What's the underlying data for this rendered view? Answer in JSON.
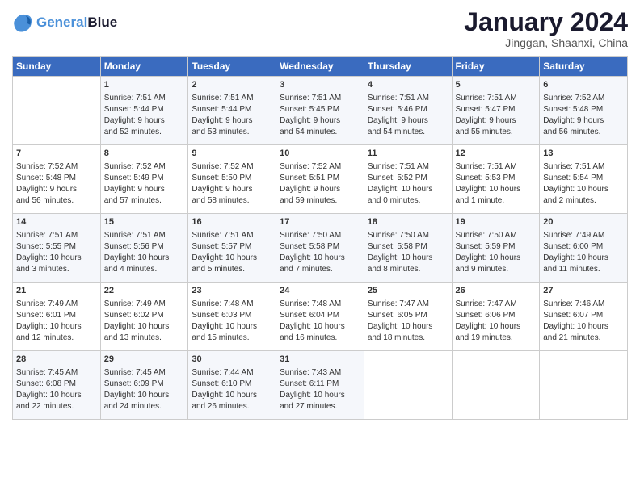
{
  "header": {
    "logo_line1": "General",
    "logo_line2": "Blue",
    "month": "January 2024",
    "location": "Jinggan, Shaanxi, China"
  },
  "weekdays": [
    "Sunday",
    "Monday",
    "Tuesday",
    "Wednesday",
    "Thursday",
    "Friday",
    "Saturday"
  ],
  "weeks": [
    [
      {
        "day": "",
        "info": ""
      },
      {
        "day": "1",
        "info": "Sunrise: 7:51 AM\nSunset: 5:44 PM\nDaylight: 9 hours\nand 52 minutes."
      },
      {
        "day": "2",
        "info": "Sunrise: 7:51 AM\nSunset: 5:44 PM\nDaylight: 9 hours\nand 53 minutes."
      },
      {
        "day": "3",
        "info": "Sunrise: 7:51 AM\nSunset: 5:45 PM\nDaylight: 9 hours\nand 54 minutes."
      },
      {
        "day": "4",
        "info": "Sunrise: 7:51 AM\nSunset: 5:46 PM\nDaylight: 9 hours\nand 54 minutes."
      },
      {
        "day": "5",
        "info": "Sunrise: 7:51 AM\nSunset: 5:47 PM\nDaylight: 9 hours\nand 55 minutes."
      },
      {
        "day": "6",
        "info": "Sunrise: 7:52 AM\nSunset: 5:48 PM\nDaylight: 9 hours\nand 56 minutes."
      }
    ],
    [
      {
        "day": "7",
        "info": "Sunrise: 7:52 AM\nSunset: 5:48 PM\nDaylight: 9 hours\nand 56 minutes."
      },
      {
        "day": "8",
        "info": "Sunrise: 7:52 AM\nSunset: 5:49 PM\nDaylight: 9 hours\nand 57 minutes."
      },
      {
        "day": "9",
        "info": "Sunrise: 7:52 AM\nSunset: 5:50 PM\nDaylight: 9 hours\nand 58 minutes."
      },
      {
        "day": "10",
        "info": "Sunrise: 7:52 AM\nSunset: 5:51 PM\nDaylight: 9 hours\nand 59 minutes."
      },
      {
        "day": "11",
        "info": "Sunrise: 7:51 AM\nSunset: 5:52 PM\nDaylight: 10 hours\nand 0 minutes."
      },
      {
        "day": "12",
        "info": "Sunrise: 7:51 AM\nSunset: 5:53 PM\nDaylight: 10 hours\nand 1 minute."
      },
      {
        "day": "13",
        "info": "Sunrise: 7:51 AM\nSunset: 5:54 PM\nDaylight: 10 hours\nand 2 minutes."
      }
    ],
    [
      {
        "day": "14",
        "info": "Sunrise: 7:51 AM\nSunset: 5:55 PM\nDaylight: 10 hours\nand 3 minutes."
      },
      {
        "day": "15",
        "info": "Sunrise: 7:51 AM\nSunset: 5:56 PM\nDaylight: 10 hours\nand 4 minutes."
      },
      {
        "day": "16",
        "info": "Sunrise: 7:51 AM\nSunset: 5:57 PM\nDaylight: 10 hours\nand 5 minutes."
      },
      {
        "day": "17",
        "info": "Sunrise: 7:50 AM\nSunset: 5:58 PM\nDaylight: 10 hours\nand 7 minutes."
      },
      {
        "day": "18",
        "info": "Sunrise: 7:50 AM\nSunset: 5:58 PM\nDaylight: 10 hours\nand 8 minutes."
      },
      {
        "day": "19",
        "info": "Sunrise: 7:50 AM\nSunset: 5:59 PM\nDaylight: 10 hours\nand 9 minutes."
      },
      {
        "day": "20",
        "info": "Sunrise: 7:49 AM\nSunset: 6:00 PM\nDaylight: 10 hours\nand 11 minutes."
      }
    ],
    [
      {
        "day": "21",
        "info": "Sunrise: 7:49 AM\nSunset: 6:01 PM\nDaylight: 10 hours\nand 12 minutes."
      },
      {
        "day": "22",
        "info": "Sunrise: 7:49 AM\nSunset: 6:02 PM\nDaylight: 10 hours\nand 13 minutes."
      },
      {
        "day": "23",
        "info": "Sunrise: 7:48 AM\nSunset: 6:03 PM\nDaylight: 10 hours\nand 15 minutes."
      },
      {
        "day": "24",
        "info": "Sunrise: 7:48 AM\nSunset: 6:04 PM\nDaylight: 10 hours\nand 16 minutes."
      },
      {
        "day": "25",
        "info": "Sunrise: 7:47 AM\nSunset: 6:05 PM\nDaylight: 10 hours\nand 18 minutes."
      },
      {
        "day": "26",
        "info": "Sunrise: 7:47 AM\nSunset: 6:06 PM\nDaylight: 10 hours\nand 19 minutes."
      },
      {
        "day": "27",
        "info": "Sunrise: 7:46 AM\nSunset: 6:07 PM\nDaylight: 10 hours\nand 21 minutes."
      }
    ],
    [
      {
        "day": "28",
        "info": "Sunrise: 7:45 AM\nSunset: 6:08 PM\nDaylight: 10 hours\nand 22 minutes."
      },
      {
        "day": "29",
        "info": "Sunrise: 7:45 AM\nSunset: 6:09 PM\nDaylight: 10 hours\nand 24 minutes."
      },
      {
        "day": "30",
        "info": "Sunrise: 7:44 AM\nSunset: 6:10 PM\nDaylight: 10 hours\nand 26 minutes."
      },
      {
        "day": "31",
        "info": "Sunrise: 7:43 AM\nSunset: 6:11 PM\nDaylight: 10 hours\nand 27 minutes."
      },
      {
        "day": "",
        "info": ""
      },
      {
        "day": "",
        "info": ""
      },
      {
        "day": "",
        "info": ""
      }
    ]
  ]
}
